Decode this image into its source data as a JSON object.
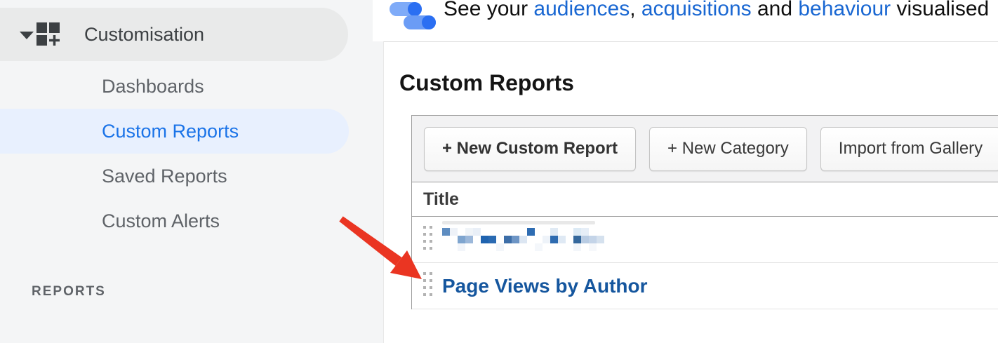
{
  "colors": {
    "sidebar_bg": "#f4f5f6",
    "section_pill_bg": "#e9eaea",
    "section_text": "#3c4043",
    "nav_text": "#5f6368",
    "active_pill_bg": "#e8f0fe",
    "active_text": "#1a73e8",
    "intro_link": "#1967d2",
    "report_link": "#15569e",
    "arrow_red": "#ea3522",
    "border_dark": "#9e9e9e",
    "border_light": "#e3e3e3",
    "toolbar_bg": "#f2f2f3",
    "handle_dot": "#b3b3b3"
  },
  "topbar": {
    "icon": "data-toggles-icon",
    "message": {
      "prefix": "See your ",
      "link_audiences": "audiences",
      "sep1": ", ",
      "link_acquisitions": "acquisitions",
      "sep2": " and ",
      "link_behaviour": "behaviour",
      "suffix": " visualised"
    }
  },
  "sidebar": {
    "section_label": "Customisation",
    "items": [
      {
        "label": "Dashboards",
        "active": false
      },
      {
        "label": "Custom Reports",
        "active": true
      },
      {
        "label": "Saved Reports",
        "active": false
      },
      {
        "label": "Custom Alerts",
        "active": false
      }
    ],
    "footer_label": "REPORTS"
  },
  "main": {
    "title": "Custom Reports",
    "toolbar_buttons": [
      {
        "label": "+ New Custom Report"
      },
      {
        "label": "+ New Category"
      },
      {
        "label": "Import from Gallery"
      }
    ],
    "table": {
      "column_title": "Title",
      "rows": [
        {
          "title": "",
          "redacted": true
        },
        {
          "title": "Page Views by Author",
          "redacted": false
        }
      ]
    }
  },
  "redacted_mosaic": {
    "cell": 11,
    "smear_color": "#e8e8e8",
    "blocks": [
      [
        0,
        0,
        "#5e8dc1"
      ],
      [
        1,
        0,
        "#eef2f8"
      ],
      [
        3,
        0,
        "#f0f4f8"
      ],
      [
        4,
        0,
        "#e9eff7"
      ],
      [
        11,
        0,
        "#2e6cb2"
      ],
      [
        14,
        0,
        "#e0eaf4"
      ],
      [
        17,
        0,
        "#dceaf5"
      ],
      [
        18,
        0,
        "#e6eef7"
      ],
      [
        2,
        1,
        "#7fa5cf"
      ],
      [
        3,
        1,
        "#9cb8da"
      ],
      [
        5,
        1,
        "#1f63af"
      ],
      [
        6,
        1,
        "#2a6ab2"
      ],
      [
        8,
        1,
        "#3d6ea8"
      ],
      [
        9,
        1,
        "#6d95c5"
      ],
      [
        10,
        1,
        "#dce6f2"
      ],
      [
        13,
        1,
        "#eef3f9"
      ],
      [
        14,
        1,
        "#2e6bb0"
      ],
      [
        15,
        1,
        "#dfe9f4"
      ],
      [
        17,
        1,
        "#35689c"
      ],
      [
        18,
        1,
        "#b9cce3"
      ],
      [
        19,
        1,
        "#c4d4e8"
      ],
      [
        20,
        1,
        "#d5e1ee"
      ],
      [
        2,
        2,
        "#f2f5fa"
      ],
      [
        7,
        2,
        "#f3f6fa"
      ],
      [
        12,
        2,
        "#f4f7fb"
      ],
      [
        17,
        2,
        "#f3f6fa"
      ],
      [
        19,
        2,
        "#f6f8fb"
      ]
    ]
  }
}
